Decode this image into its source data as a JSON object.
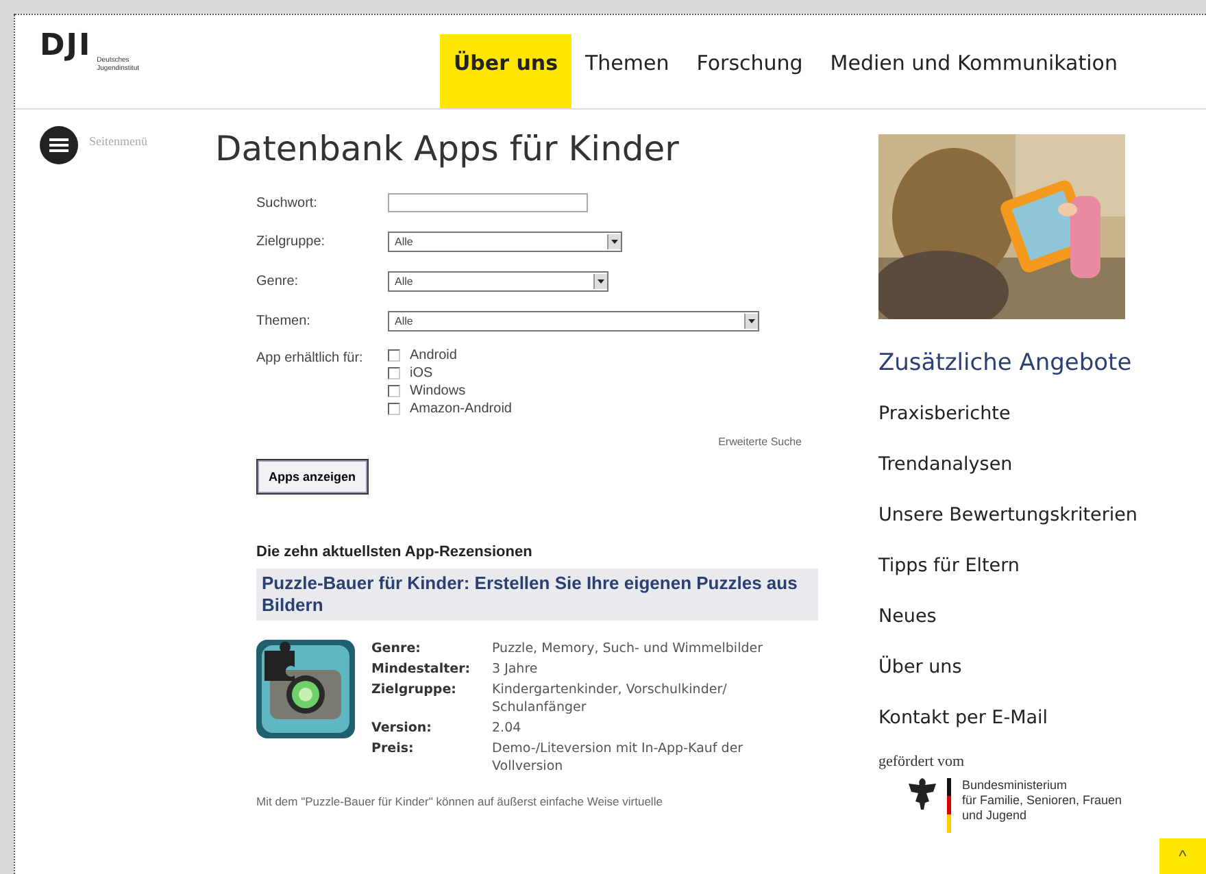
{
  "header": {
    "logo": {
      "mark": "DJI",
      "line1": "Deutsches",
      "line2": "Jugendinstitut"
    },
    "nav": [
      {
        "label": "Über uns",
        "selected": true
      },
      {
        "label": "Themen",
        "selected": false
      },
      {
        "label": "Forschung",
        "selected": false
      },
      {
        "label": "Medien und Kommunikation",
        "selected": false
      }
    ]
  },
  "side_menu": {
    "label": "Seitenmenü"
  },
  "page_title": "Datenbank Apps für Kinder",
  "form": {
    "fields": [
      {
        "kind": "text",
        "label": "Suchwort:"
      },
      {
        "kind": "select",
        "label": "Zielgruppe:",
        "value": "Alle"
      },
      {
        "kind": "select",
        "label": "Genre:",
        "value": "Alle"
      },
      {
        "kind": "select",
        "label": "Themen:",
        "value": "Alle"
      }
    ],
    "availability": {
      "label": "App erhältlich für:",
      "options": [
        {
          "label": "Android",
          "checked": false
        },
        {
          "label": "iOS",
          "checked": false
        },
        {
          "label": "Windows",
          "checked": false
        },
        {
          "label": "Amazon-Android",
          "checked": false
        }
      ]
    },
    "advanced_search": "Erweiterte Suche",
    "submit": "Apps anzeigen"
  },
  "reviews": {
    "heading": "Die zehn aktuellsten App-Rezensionen",
    "items": [
      {
        "title": "Puzzle-Bauer für Kinder: Erstellen Sie Ihre eigenen Puzzles aus Bildern",
        "meta": [
          {
            "label": "Genre:",
            "value": "Puzzle, Memory, Such- und Wimmelbilder"
          },
          {
            "label": "Mindestalter:",
            "value": "3 Jahre"
          },
          {
            "label": "Zielgruppe:",
            "value": "Kindergartenkinder, Vorschulkinder/ Schulanfänger"
          },
          {
            "label": "Version:",
            "value": "2.04"
          },
          {
            "label": "Preis:",
            "value": "Demo-/Liteversion mit In-App-Kauf der Vollversion"
          }
        ],
        "excerpt": "Mit dem \"Puzzle-Bauer für Kinder\" können auf äußerst einfache Weise virtuelle"
      }
    ]
  },
  "sidebar": {
    "heading": "Zusätzliche Angebote",
    "links": [
      "Praxisberichte",
      "Trendanalysen",
      "Unsere Bewertungskriterien",
      "Tipps für Eltern",
      "Neues",
      "Über uns",
      "Kontakt per E-Mail"
    ],
    "funding": {
      "label": "gefördert vom",
      "ministry": [
        "Bundesministerium",
        "für Familie, Senioren, Frauen",
        "und Jugend"
      ]
    }
  },
  "back_to_top": "^"
}
